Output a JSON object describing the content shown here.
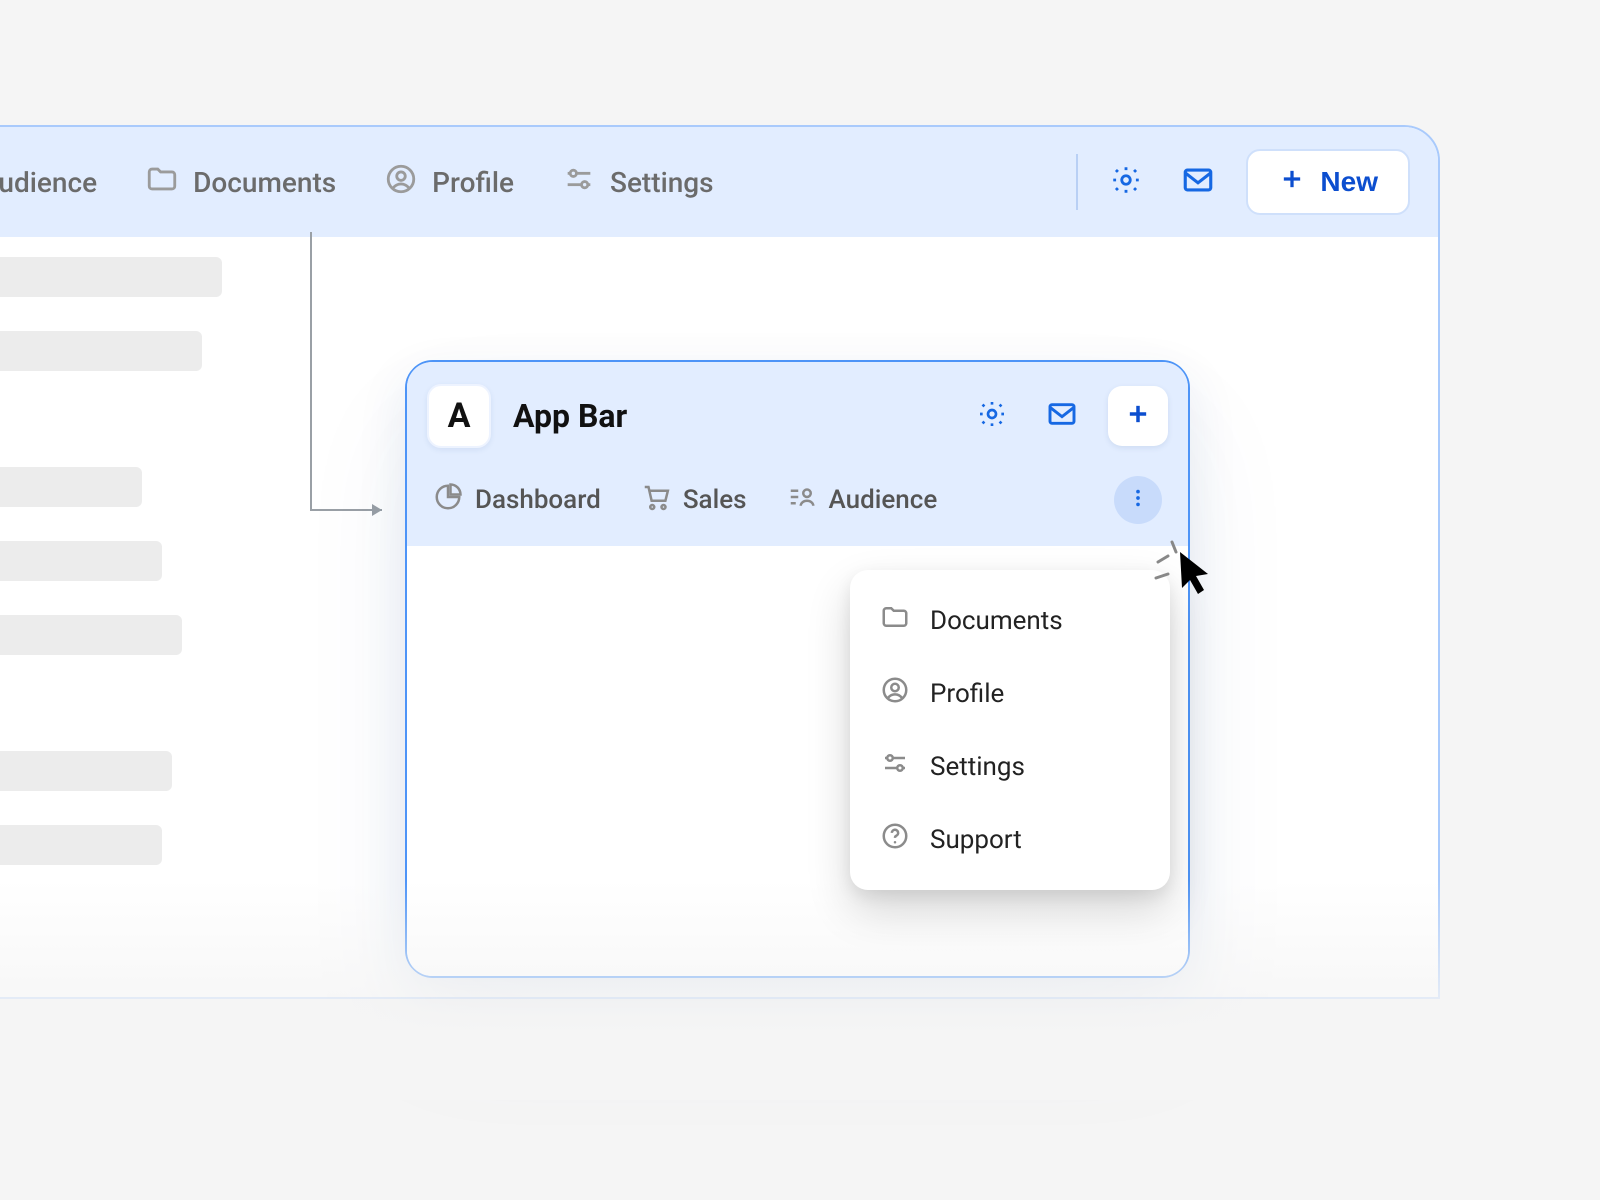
{
  "big": {
    "nav": {
      "audience": "Audience",
      "documents": "Documents",
      "profile": "Profile",
      "settings": "Settings"
    },
    "new_label": "New"
  },
  "small": {
    "logo_letter": "A",
    "title": "App Bar",
    "tabs": {
      "dashboard": "Dashboard",
      "sales": "Sales",
      "audience": "Audience"
    }
  },
  "overflow_menu": {
    "documents": "Documents",
    "profile": "Profile",
    "settings": "Settings",
    "support": "Support"
  },
  "colors": {
    "accent": "#1668e3",
    "appbar_bg": "#e2edff"
  }
}
